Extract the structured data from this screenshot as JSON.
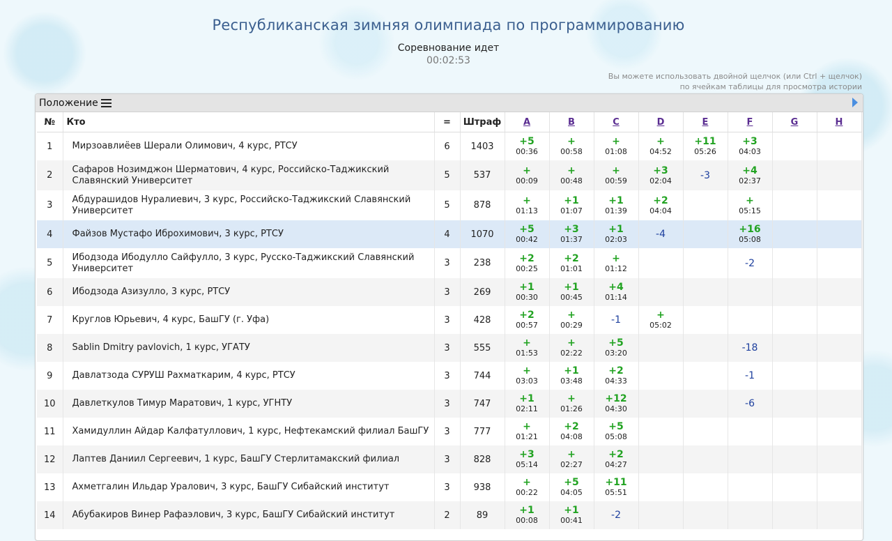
{
  "header": {
    "title": "Республиканская зимняя олимпиада по программированию",
    "status": "Соревнование идет",
    "timer": "00:02:53",
    "hint_line1": "Вы можете использовать двойной щелчок (или Ctrl + щелчок)",
    "hint_line2": "по ячейкам таблицы для просмотра истории"
  },
  "panel": {
    "title": "Положение"
  },
  "table": {
    "columns": {
      "num": "№",
      "who": "Кто",
      "solved": "=",
      "penalty": "Штраф"
    },
    "problems": [
      "A",
      "B",
      "C",
      "D",
      "E",
      "F",
      "G",
      "H"
    ],
    "rows": [
      {
        "n": "1",
        "who": "Мирзоавлиёев Шерали Олимович, 4 курс, РТСУ",
        "solved": "6",
        "penalty": "1403",
        "cells": [
          {
            "r": "+5",
            "t": "00:36"
          },
          {
            "r": "+",
            "t": "00:58"
          },
          {
            "r": "+",
            "t": "01:08"
          },
          {
            "r": "+",
            "t": "04:52"
          },
          {
            "r": "+11",
            "t": "05:26"
          },
          {
            "r": "+3",
            "t": "04:03"
          },
          {},
          {}
        ]
      },
      {
        "n": "2",
        "who": "Сафаров Нозимджон Шерматович, 4 курс, Российско-Таджикский Славянский Университет",
        "solved": "5",
        "penalty": "537",
        "cells": [
          {
            "r": "+",
            "t": "00:09"
          },
          {
            "r": "+",
            "t": "00:48"
          },
          {
            "r": "+",
            "t": "00:59"
          },
          {
            "r": "+3",
            "t": "02:04"
          },
          {
            "r": "-3"
          },
          {
            "r": "+4",
            "t": "02:37"
          },
          {},
          {}
        ]
      },
      {
        "n": "3",
        "who": "Абдурашидов Нуралиевич, 3 курс, Российско-Таджикский Славянский Университет",
        "solved": "5",
        "penalty": "878",
        "cells": [
          {
            "r": "+",
            "t": "01:13"
          },
          {
            "r": "+1",
            "t": "01:07"
          },
          {
            "r": "+1",
            "t": "01:39"
          },
          {
            "r": "+2",
            "t": "04:04"
          },
          {},
          {
            "r": "+",
            "t": "05:15"
          },
          {},
          {}
        ]
      },
      {
        "n": "4",
        "who": "Файзов Мустафо Иброхимович, 3 курс, РТСУ",
        "solved": "4",
        "penalty": "1070",
        "highlight": true,
        "cells": [
          {
            "r": "+5",
            "t": "00:42"
          },
          {
            "r": "+3",
            "t": "01:37"
          },
          {
            "r": "+1",
            "t": "02:03"
          },
          {
            "r": "-4"
          },
          {},
          {
            "r": "+16",
            "t": "05:08"
          },
          {},
          {}
        ]
      },
      {
        "n": "5",
        "who": "Ибодзода Ибодулло Сайфулло, 3 курс, Русско-Таджикский Славянский Университет",
        "solved": "3",
        "penalty": "238",
        "cells": [
          {
            "r": "+2",
            "t": "00:25"
          },
          {
            "r": "+2",
            "t": "01:01"
          },
          {
            "r": "+",
            "t": "01:12"
          },
          {},
          {},
          {
            "r": "-2"
          },
          {},
          {}
        ]
      },
      {
        "n": "6",
        "who": "Ибодзода Азизулло, 3 курс, РТСУ",
        "solved": "3",
        "penalty": "269",
        "cells": [
          {
            "r": "+1",
            "t": "00:30"
          },
          {
            "r": "+1",
            "t": "00:45"
          },
          {
            "r": "+4",
            "t": "01:14"
          },
          {},
          {},
          {},
          {},
          {}
        ]
      },
      {
        "n": "7",
        "who": "Круглов Юрьевич, 4 курс, БашГУ (г. Уфа)",
        "solved": "3",
        "penalty": "428",
        "cells": [
          {
            "r": "+2",
            "t": "00:57"
          },
          {
            "r": "+",
            "t": "00:29"
          },
          {
            "r": "-1"
          },
          {
            "r": "+",
            "t": "05:02"
          },
          {},
          {},
          {},
          {}
        ]
      },
      {
        "n": "8",
        "who": "Sablin Dmitry pavlovich, 1 курс, УГАТУ",
        "solved": "3",
        "penalty": "555",
        "cells": [
          {
            "r": "+",
            "t": "01:53"
          },
          {
            "r": "+",
            "t": "02:22"
          },
          {
            "r": "+5",
            "t": "03:20"
          },
          {},
          {},
          {
            "r": "-18"
          },
          {},
          {}
        ]
      },
      {
        "n": "9",
        "who": "Давлатзода СУРУШ Рахматкарим, 4 курс, РТСУ",
        "solved": "3",
        "penalty": "744",
        "cells": [
          {
            "r": "+",
            "t": "03:03"
          },
          {
            "r": "+1",
            "t": "03:48"
          },
          {
            "r": "+2",
            "t": "04:33"
          },
          {},
          {},
          {
            "r": "-1"
          },
          {},
          {}
        ]
      },
      {
        "n": "10",
        "who": "Давлеткулов Тимур Маратович, 1 курс, УГНТУ",
        "solved": "3",
        "penalty": "747",
        "cells": [
          {
            "r": "+1",
            "t": "02:11"
          },
          {
            "r": "+",
            "t": "01:26"
          },
          {
            "r": "+12",
            "t": "04:30"
          },
          {},
          {},
          {
            "r": "-6"
          },
          {},
          {}
        ]
      },
      {
        "n": "11",
        "who": "Хамидуллин Айдар Калфатуллович, 1 курс, Нефтекамский филиал БашГУ",
        "solved": "3",
        "penalty": "777",
        "cells": [
          {
            "r": "+",
            "t": "01:21"
          },
          {
            "r": "+2",
            "t": "04:08"
          },
          {
            "r": "+5",
            "t": "05:08"
          },
          {},
          {},
          {},
          {},
          {}
        ]
      },
      {
        "n": "12",
        "who": "Лаптев Даниил Сергеевич, 1 курс, БашГУ Стерлитамакский филиал",
        "solved": "3",
        "penalty": "828",
        "cells": [
          {
            "r": "+3",
            "t": "05:14"
          },
          {
            "r": "+",
            "t": "02:27"
          },
          {
            "r": "+2",
            "t": "04:27"
          },
          {},
          {},
          {},
          {},
          {}
        ]
      },
      {
        "n": "13",
        "who": "Ахметгалин Ильдар Уралович, 3 курс, БашГУ Сибайский институт",
        "solved": "3",
        "penalty": "938",
        "cells": [
          {
            "r": "+",
            "t": "00:22"
          },
          {
            "r": "+5",
            "t": "04:05"
          },
          {
            "r": "+11",
            "t": "05:51"
          },
          {},
          {},
          {},
          {},
          {}
        ]
      },
      {
        "n": "14",
        "who": "Абубакиров Винер Рафаэлович, 3 курс, БашГУ Сибайский институт",
        "solved": "2",
        "penalty": "89",
        "cells": [
          {
            "r": "+1",
            "t": "00:08"
          },
          {
            "r": "+1",
            "t": "00:41"
          },
          {
            "r": "-2"
          },
          {},
          {},
          {},
          {},
          {}
        ]
      }
    ]
  },
  "colors": {
    "accepted": "#22a322",
    "rejected": "#1d3f9e",
    "highlight_row": "#dce9f7",
    "title": "#3b5f8f"
  }
}
